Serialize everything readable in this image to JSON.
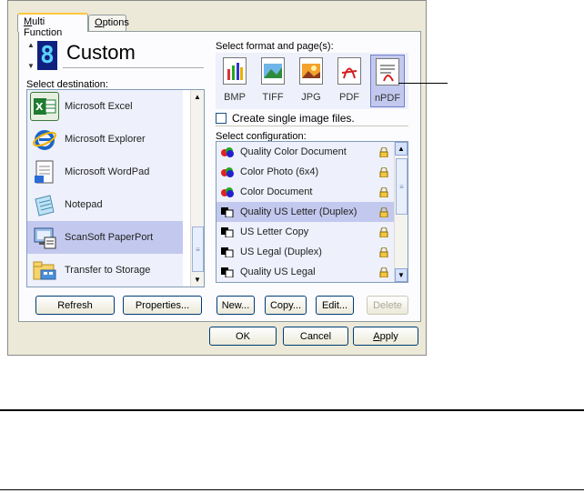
{
  "tabs": [
    {
      "label": "Multi Function",
      "accel": "M",
      "rest": "ulti Function"
    },
    {
      "label": "Options",
      "accel": "O",
      "rest": "ptions"
    }
  ],
  "button_number": "8",
  "button_name": "Custom",
  "destination": {
    "label": "Select destination:",
    "items": [
      {
        "label": "Microsoft Excel",
        "icon": "excel-icon",
        "selected": false
      },
      {
        "label": "Microsoft Explorer",
        "icon": "internet-explorer-icon",
        "selected": false
      },
      {
        "label": "Microsoft WordPad",
        "icon": "wordpad-icon",
        "selected": false
      },
      {
        "label": "Notepad",
        "icon": "notepad-icon",
        "selected": false
      },
      {
        "label": "ScanSoft PaperPort",
        "icon": "paperport-icon",
        "selected": true
      },
      {
        "label": "Transfer to Storage",
        "icon": "folder-storage-icon",
        "selected": false
      }
    ]
  },
  "format": {
    "label": "Select format and page(s):",
    "items": [
      {
        "label": "BMP",
        "selected": false
      },
      {
        "label": "TIFF",
        "selected": false
      },
      {
        "label": "JPG",
        "selected": false
      },
      {
        "label": "PDF",
        "selected": false
      },
      {
        "label": "nPDF",
        "selected": true
      }
    ],
    "single_image_checkbox": "Create single image files.",
    "single_image_checked": false
  },
  "configuration": {
    "label": "Select configuration:",
    "items": [
      {
        "label": "Quality Color Document",
        "icon": "color-icon",
        "selected": false
      },
      {
        "label": "Color Photo (6x4)",
        "icon": "color-icon",
        "selected": false
      },
      {
        "label": "Color Document",
        "icon": "color-icon",
        "selected": false
      },
      {
        "label": "Quality US Letter (Duplex)",
        "icon": "bw-icon",
        "selected": true
      },
      {
        "label": "US Letter Copy",
        "icon": "bw-icon",
        "selected": false
      },
      {
        "label": "US Legal (Duplex)",
        "icon": "bw-icon",
        "selected": false
      },
      {
        "label": "Quality US Legal",
        "icon": "bw-icon",
        "selected": false
      }
    ]
  },
  "buttons": {
    "refresh": "Refresh",
    "properties": "Properties...",
    "new": "New...",
    "copy": "Copy...",
    "edit": "Edit...",
    "delete": "Delete",
    "ok": "OK",
    "cancel": "Cancel",
    "apply": "Apply"
  },
  "colors": {
    "selection": "#c3c9ee",
    "dialog_bg": "#ece9d8",
    "led": "#1f55ff"
  }
}
